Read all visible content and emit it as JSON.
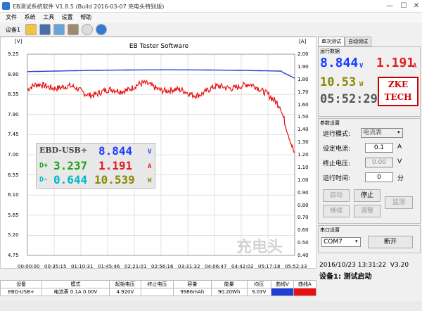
{
  "window": {
    "title": "EB测试系统软件 V1.8.5 (Build 2016-03-07 充电头特别版)"
  },
  "menu": [
    "文件",
    "系统",
    "工具",
    "设置",
    "帮助"
  ],
  "toolbar": {
    "device_label": "设备1"
  },
  "chart_data": {
    "type": "line",
    "title": "EB Tester Software",
    "ylabel_left": "[V]",
    "ylabel_right": "[A]",
    "y_left_ticks": [
      "9.25",
      "8.80",
      "8.35",
      "7.90",
      "7.45",
      "7.00",
      "6.55",
      "6.10",
      "5.65",
      "5.20",
      "4.75"
    ],
    "y_right_ticks": [
      "2.00",
      "1.90",
      "1.80",
      "1.70",
      "1.60",
      "1.50",
      "1.40",
      "1.30",
      "1.20",
      "1.10",
      "1.00",
      "0.90",
      "0.80",
      "0.70",
      "0.60",
      "0.50",
      "0.40"
    ],
    "x_ticks": [
      "00:00:00",
      "00:35:15",
      "01:10:31",
      "01:45:46",
      "02:21:01",
      "02:56:16",
      "03:31:32",
      "04:06:47",
      "04:42:02",
      "05:17:18",
      "05:52:33"
    ],
    "ylim_left": [
      4.75,
      9.25
    ],
    "ylim_right": [
      0.4,
      2.0
    ],
    "grid": true,
    "series": [
      {
        "name": "曲线V",
        "color": "#1f3fd6",
        "axis": "left",
        "approx": "flat ~8.85 V, slight rise to ~8.9, drops to ~8.78 at end"
      },
      {
        "name": "曲线A",
        "color": "#e81010",
        "axis": "right",
        "approx": "noisy ~1.72 A, dips to ~1.7, plateau ~1.75, falls to ~1.2 A at 05:52:33"
      }
    ]
  },
  "watermark": "充电头",
  "overlay": {
    "model": "EBD-USB+",
    "dp_label": "D+",
    "dp_value": "3.237",
    "dm_label": "D-",
    "dm_value": "0.644",
    "voltage": "8.844",
    "voltage_unit": "V",
    "current": "1.191",
    "current_unit": "A",
    "power": "10.539",
    "power_unit": "W"
  },
  "right": {
    "tabs": [
      "单次测试",
      "自动测试"
    ],
    "realtime_caption": "运行数据",
    "voltage": "8.844",
    "voltage_unit": "V",
    "current": "1.191",
    "current_unit": "A",
    "power": "10.53",
    "power_unit": "W",
    "elapsed": "05:52:29",
    "logo": "ZKE TECH",
    "params_caption": "参数设置",
    "mode_label": "运行模式:",
    "mode_value": "电流表",
    "setcur_label": "设定电流:",
    "setcur_value": "0.1",
    "setcur_unit": "A",
    "stopv_label": "终止电压:",
    "stopv_value": "0.00",
    "stopv_unit": "V",
    "runtime_label": "运行时间:",
    "runtime_value": "0",
    "runtime_unit": "分",
    "btn_start": "启动",
    "btn_stop": "停止",
    "btn_monitor": "监测",
    "btn_continue": "继续",
    "btn_adjust": "调整",
    "port_caption": "串口设置",
    "port_value": "COM7",
    "btn_disconnect": "断开",
    "datetime": "2016/10/23 13:31:22",
    "version": "V3.20",
    "status": "设备1: 测试启动"
  },
  "table": {
    "headers": [
      "设备",
      "模式",
      "起始电压",
      "终止电压",
      "容量",
      "能量",
      "均压",
      "曲线V",
      "曲线A"
    ],
    "row": [
      "EBD-USB+",
      "电流表 0.1A 0.00V",
      "4.920V",
      "",
      "9986mAh",
      "90.20Wh",
      "9.03V",
      "",
      ""
    ]
  },
  "colors": {
    "voltage": "#1f3fd6",
    "current": "#e81010",
    "lcd_blue": "#1a3cff",
    "lcd_red": "#e21e1e",
    "lcd_green": "#1aa51a",
    "lcd_cyan": "#00b7c8",
    "lcd_olive": "#8a8a00"
  }
}
